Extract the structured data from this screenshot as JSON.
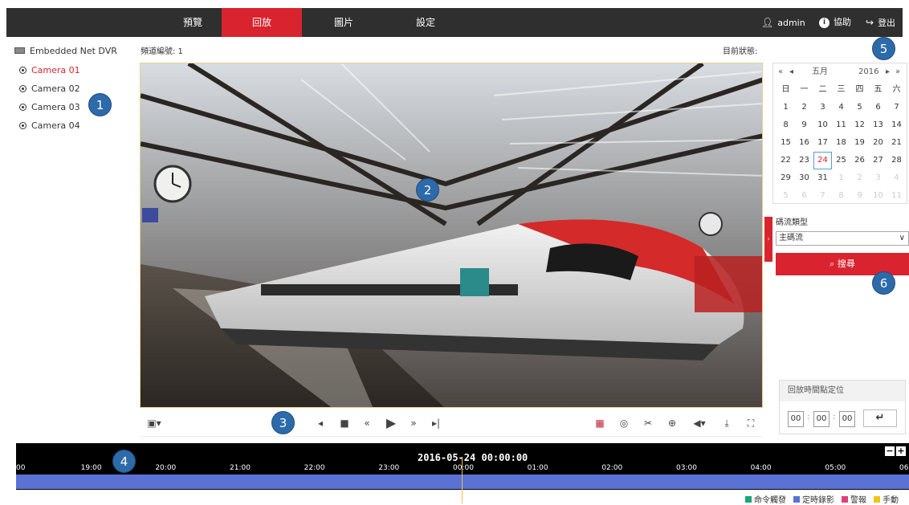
{
  "nav": {
    "tabs": [
      {
        "label": "預覽"
      },
      {
        "label": "回放"
      },
      {
        "label": "圖片"
      },
      {
        "label": "設定"
      }
    ],
    "active_tab": "回放",
    "user": "admin",
    "help": "協助",
    "logout": "登出"
  },
  "sidebar": {
    "device": "Embedded Net DVR",
    "cameras": [
      "Camera 01",
      "Camera 02",
      "Camera 03",
      "Camera 04"
    ],
    "active_camera": "Camera 01"
  },
  "header": {
    "channel_label": "頻道編號: 1",
    "status_label": "目前狀態:"
  },
  "calendar": {
    "month": "五月",
    "year": "2016",
    "weekdays": [
      "日",
      "一",
      "二",
      "三",
      "四",
      "五",
      "六"
    ],
    "days": [
      [
        "1",
        "2",
        "3",
        "4",
        "5",
        "6",
        "7"
      ],
      [
        "8",
        "9",
        "10",
        "11",
        "12",
        "13",
        "14"
      ],
      [
        "15",
        "16",
        "17",
        "18",
        "19",
        "20",
        "21"
      ],
      [
        "22",
        "23",
        "24",
        "25",
        "26",
        "27",
        "28"
      ],
      [
        "29",
        "30",
        "31",
        "1",
        "2",
        "3",
        "4"
      ],
      [
        "5",
        "6",
        "7",
        "8",
        "9",
        "10",
        "11"
      ]
    ],
    "selected_day": "24"
  },
  "stream": {
    "label": "碼流類型",
    "value": "主碼流",
    "search_label": "搜尋"
  },
  "locate": {
    "title": "回放時間點定位",
    "hh": "00",
    "mm": "00",
    "ss": "00"
  },
  "timeline": {
    "datetime": "2016-05-24 00:00:00",
    "labels": [
      "00",
      "19:00",
      "20:00",
      "21:00",
      "22:00",
      "23:00",
      "00:00",
      "01:00",
      "02:00",
      "03:00",
      "04:00",
      "05:00",
      "06"
    ]
  },
  "legend": [
    {
      "label": "命令觸發",
      "color": "#1aa57a"
    },
    {
      "label": "定時錄影",
      "color": "#5a72d4"
    },
    {
      "label": "警報",
      "color": "#e0407a"
    },
    {
      "label": "手動",
      "color": "#f0c419"
    }
  ],
  "badges": [
    "1",
    "2",
    "3",
    "4",
    "5",
    "6"
  ],
  "colors": {
    "accent": "#d9232e",
    "badge": "#2d6aa9",
    "record": "#5a72d4"
  }
}
